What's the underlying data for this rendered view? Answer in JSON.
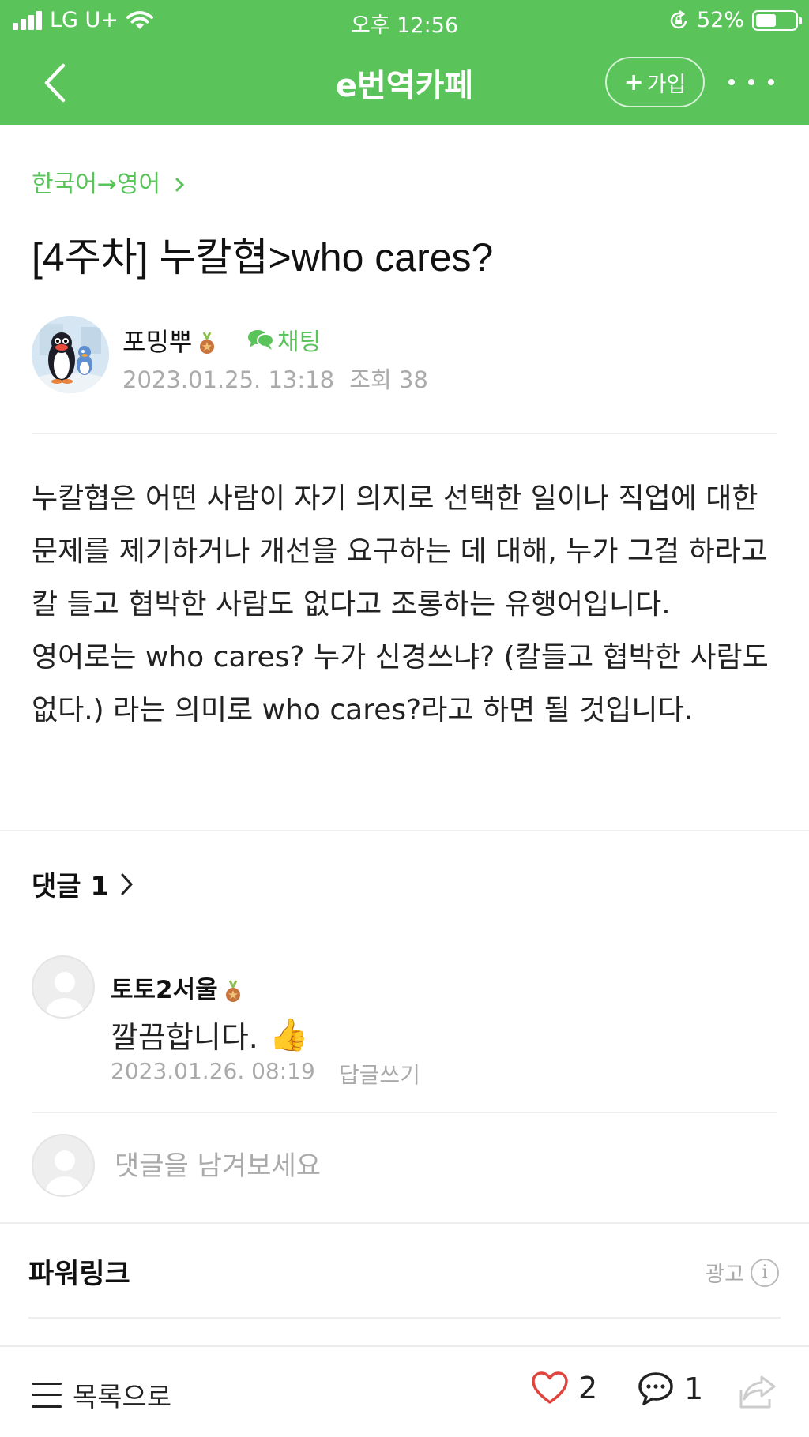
{
  "status_bar": {
    "carrier": "LG U+",
    "time": "오후 12:56",
    "battery_percent": "52%",
    "battery_level": 0.52
  },
  "nav": {
    "title": "e번역카페",
    "join_label": "가입"
  },
  "post": {
    "breadcrumb": "한국어→영어",
    "title": "[4주차] 누칼협>who cares?",
    "author": "포밍뿌",
    "chat_label": "채팅",
    "date": "2023.01.25. 13:18",
    "views_label": "조회",
    "views": "38",
    "body": "누칼협은 어떤 사람이 자기 의지로 선택한 일이나 직업에 대한 문제를 제기하거나 개선을 요구하는 데 대해, 누가 그걸 하라고 칼 들고 협박한 사람도 없다고 조롱하는 유행어입니다. 영어로는 who cares? 누가 신경쓰냐? (칼들고 협박한 사람도 없다.) 라는 의미로 who cares?라고 하면 될 것입니다."
  },
  "comments": {
    "header_label": "댓글",
    "count": "1",
    "items": [
      {
        "author": "토토2서울",
        "text": "깔끔합니다.",
        "emoji": "👍",
        "date": "2023.01.26. 08:19",
        "reply_label": "답글쓰기"
      }
    ],
    "input_placeholder": "댓글을 남겨보세요"
  },
  "powerlink": {
    "title": "파워링크",
    "ad_label": "광고"
  },
  "bottom_bar": {
    "list_label": "목록으로",
    "like_count": "2",
    "comment_count": "1"
  },
  "icons": {
    "back": "chevron-left-icon",
    "more": "more-dots-icon",
    "chat": "chat-bubble-icon",
    "medal": "medal-icon",
    "like": "heart-icon",
    "comment": "comment-bubble-icon",
    "share": "share-icon",
    "info": "info-icon",
    "menu": "hamburger-icon"
  },
  "colors": {
    "brand_green": "#5ac45a",
    "heart_red": "#e0443e",
    "muted_text": "#aaaaaa"
  }
}
